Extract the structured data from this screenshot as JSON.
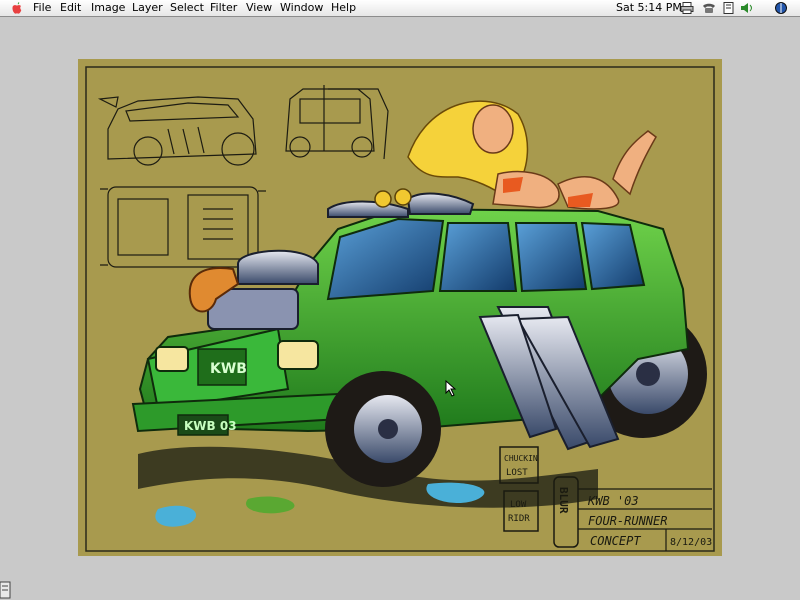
{
  "menubar": {
    "items": [
      "File",
      "Edit",
      "Image",
      "Layer",
      "Select",
      "Filter",
      "View",
      "Window",
      "Help"
    ],
    "clock": "Sat 5:14 PM"
  },
  "artwork": {
    "plate_text": "KWB 03",
    "grille_badge": "KWB",
    "logo_text": "BLUR",
    "title_lines": [
      "KWB '03",
      "FOUR-RUNNER",
      "CONCEPT"
    ],
    "date_text": "8/12/03",
    "signature_1": [
      "CHUCKIN",
      "LOST"
    ],
    "signature_2": [
      "LOW",
      "RIDR"
    ]
  },
  "colors": {
    "menubar": "#eeeeee",
    "desktop": "#c9c9c9",
    "canvas_bg": "#a89a4e",
    "car_body": "#2fa02a"
  }
}
